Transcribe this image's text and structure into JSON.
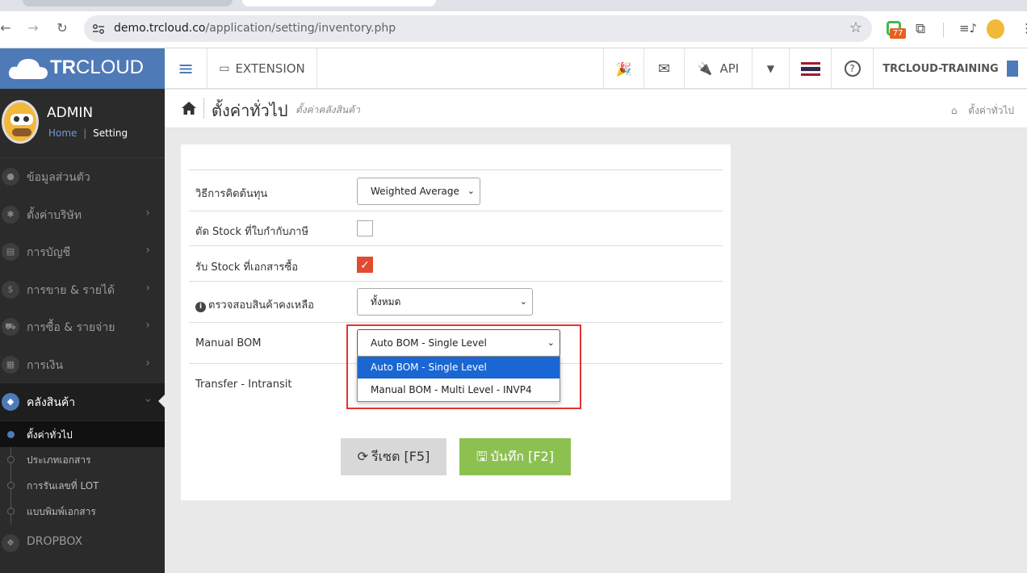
{
  "browser": {
    "url_domain": "demo.trcloud.co",
    "url_path": "/application/setting/inventory.php",
    "extension_badge": "77"
  },
  "header": {
    "logo_text_bold": "TR",
    "logo_text": "CLOUD",
    "extension_label": "EXTENSION",
    "api_label": "API",
    "account_label": "TRCLOUD-TRAINING"
  },
  "sidebar": {
    "user_name": "ADMIN",
    "crumb_home": "Home",
    "crumb_sep": "|",
    "crumb_current": "Setting",
    "items": [
      {
        "label": "ข้อมูลส่วนตัว",
        "icon": "user-icon"
      },
      {
        "label": "ตั้งค่าบริษัท",
        "icon": "gear-icon"
      },
      {
        "label": "การบัญชี",
        "icon": "book-icon"
      },
      {
        "label": "การขาย & รายได้",
        "icon": "dollar-icon"
      },
      {
        "label": "การซื้อ & รายจ่าย",
        "icon": "cart-icon"
      },
      {
        "label": "การเงิน",
        "icon": "calendar-icon"
      },
      {
        "label": "คลังสินค้า",
        "icon": "cube-icon"
      }
    ],
    "subitems": [
      "ตั้งค่าทั่วไป",
      "ประเภทเอกสาร",
      "การรันเลขที่ LOT",
      "แบบพิมพ์เอกสาร"
    ],
    "dropbox": "DROPBOX"
  },
  "page": {
    "title": "ตั้งค่าทั่วไป",
    "subtitle": "ตั้งค่าคลังสินค้า",
    "breadcrumb": "ตั้งค่าทั่วไป"
  },
  "form": {
    "cost_method_label": "วิธีการคิดต้นทุน",
    "cost_method_value": "Weighted Average",
    "cut_stock_label": "ตัด Stock ที่ใบกำกับภาษี",
    "cut_stock_checked": false,
    "receive_stock_label": "รับ Stock ที่เอกสารซื้อ",
    "receive_stock_checked": true,
    "check_remaining_label": "ตรวจสอบสินค้าคงเหลือ",
    "check_remaining_value": "ทั้งหมด",
    "manual_bom_label": "Manual BOM",
    "manual_bom_value": "Auto BOM - Single Level",
    "manual_bom_options": [
      "Auto BOM - Single Level",
      "Manual BOM - Multi Level - INVP4"
    ],
    "transfer_label": "Transfer - Intransit",
    "reset_label": "รีเซต [F5]",
    "save_label": "บันทึก [F2]"
  },
  "colors": {
    "brand": "#4f7ab8",
    "save": "#8cc152",
    "highlight": "#e23333",
    "option_selected": "#1a66d2"
  }
}
